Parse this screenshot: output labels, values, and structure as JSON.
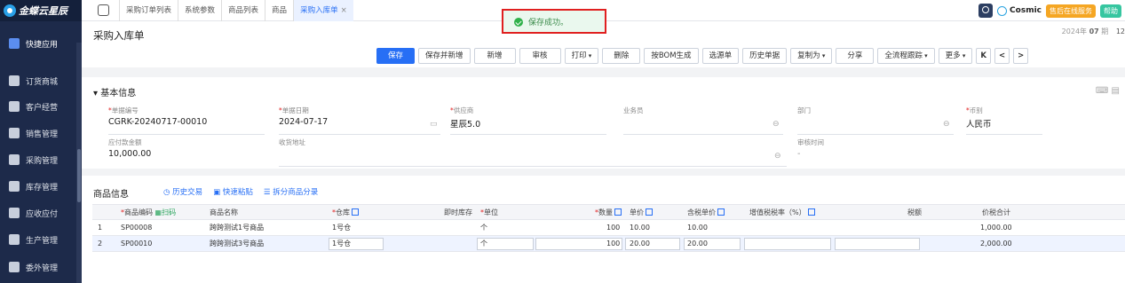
{
  "sidebar": {
    "logo": "金蝶云星辰",
    "items": [
      {
        "label": "快捷应用",
        "icon": "grid-icon"
      },
      {
        "label": "订货商城",
        "icon": "shop-icon"
      },
      {
        "label": "客户经营",
        "icon": "customer-icon"
      },
      {
        "label": "销售管理",
        "icon": "sales-icon"
      },
      {
        "label": "采购管理",
        "icon": "cart-icon"
      },
      {
        "label": "库存管理",
        "icon": "box-icon"
      },
      {
        "label": "应收应付",
        "icon": "money-icon"
      },
      {
        "label": "生产管理",
        "icon": "factory-icon"
      },
      {
        "label": "委外管理",
        "icon": "outsource-icon"
      }
    ]
  },
  "topbar": {
    "tabs": [
      "采购订单列表",
      "系统参数",
      "商品列表",
      "商品",
      "采购入库单"
    ],
    "active_tab": "采购入库单",
    "close_glyph": "×",
    "cosmic": "Cosmic",
    "after_sale": "售后在线服务",
    "help": "帮助"
  },
  "toast": {
    "message": "保存成功。"
  },
  "header": {
    "title": "采购入库单",
    "date_year": "2024年",
    "date_month": "07",
    "date_suffix": "期",
    "date_extra": "12"
  },
  "toolbar": {
    "save": "保存",
    "save_new": "保存并新增",
    "add": "新增",
    "audit": "审核",
    "print": "打印",
    "delete": "删除",
    "bom": "按BOM生成",
    "select_doc": "选源单",
    "history": "历史单据",
    "copy_as": "复制为",
    "share": "分享",
    "trace": "全流程跟踪",
    "more": "更多",
    "nav_first": "K",
    "nav_prev": "<",
    "nav_next": ">"
  },
  "basic": {
    "section": "基本信息",
    "fields": {
      "doc_no_label": "单据编号",
      "doc_no": "CGRK-20240717-00010",
      "date_label": "单据日期",
      "date": "2024-07-17",
      "supplier_label": "供应商",
      "supplier": "星辰5.0",
      "salesman_label": "业务员",
      "salesman": "",
      "dept_label": "部门",
      "dept": "",
      "currency_label": "币别",
      "currency": "人民币",
      "payable_label": "应付款金额",
      "payable": "10,000.00",
      "address_label": "收货地址",
      "address": "",
      "audit_time_label": "审核时间",
      "audit_time": "-"
    }
  },
  "goods": {
    "section": "商品信息",
    "links": [
      "历史交易",
      "快速粘贴",
      "拆分商品分录"
    ],
    "headers": {
      "code": "商品编码",
      "scan": "扫码",
      "name": "商品名称",
      "warehouse": "仓库",
      "stock": "即时库存",
      "unit": "单位",
      "qty": "数量",
      "price": "单价",
      "tax_price": "含税单价",
      "tax_rate": "增值税税率（%）",
      "tax": "税额",
      "total": "价税合计"
    },
    "rows": [
      {
        "no": "1",
        "code": "SP00008",
        "name": "跨跨测试1号商品",
        "warehouse": "1号仓",
        "stock": "",
        "unit": "个",
        "qty": "100",
        "price": "10.00",
        "tax_price": "10.00",
        "tax_rate": "",
        "tax": "",
        "total": "1,000.00"
      },
      {
        "no": "2",
        "code": "SP00010",
        "name": "跨跨测试3号商品",
        "warehouse": "1号仓",
        "stock": "",
        "unit": "个",
        "qty": "100",
        "price": "20.00",
        "tax_price": "20.00",
        "tax_rate": "",
        "tax": "",
        "total": "2,000.00"
      }
    ]
  }
}
